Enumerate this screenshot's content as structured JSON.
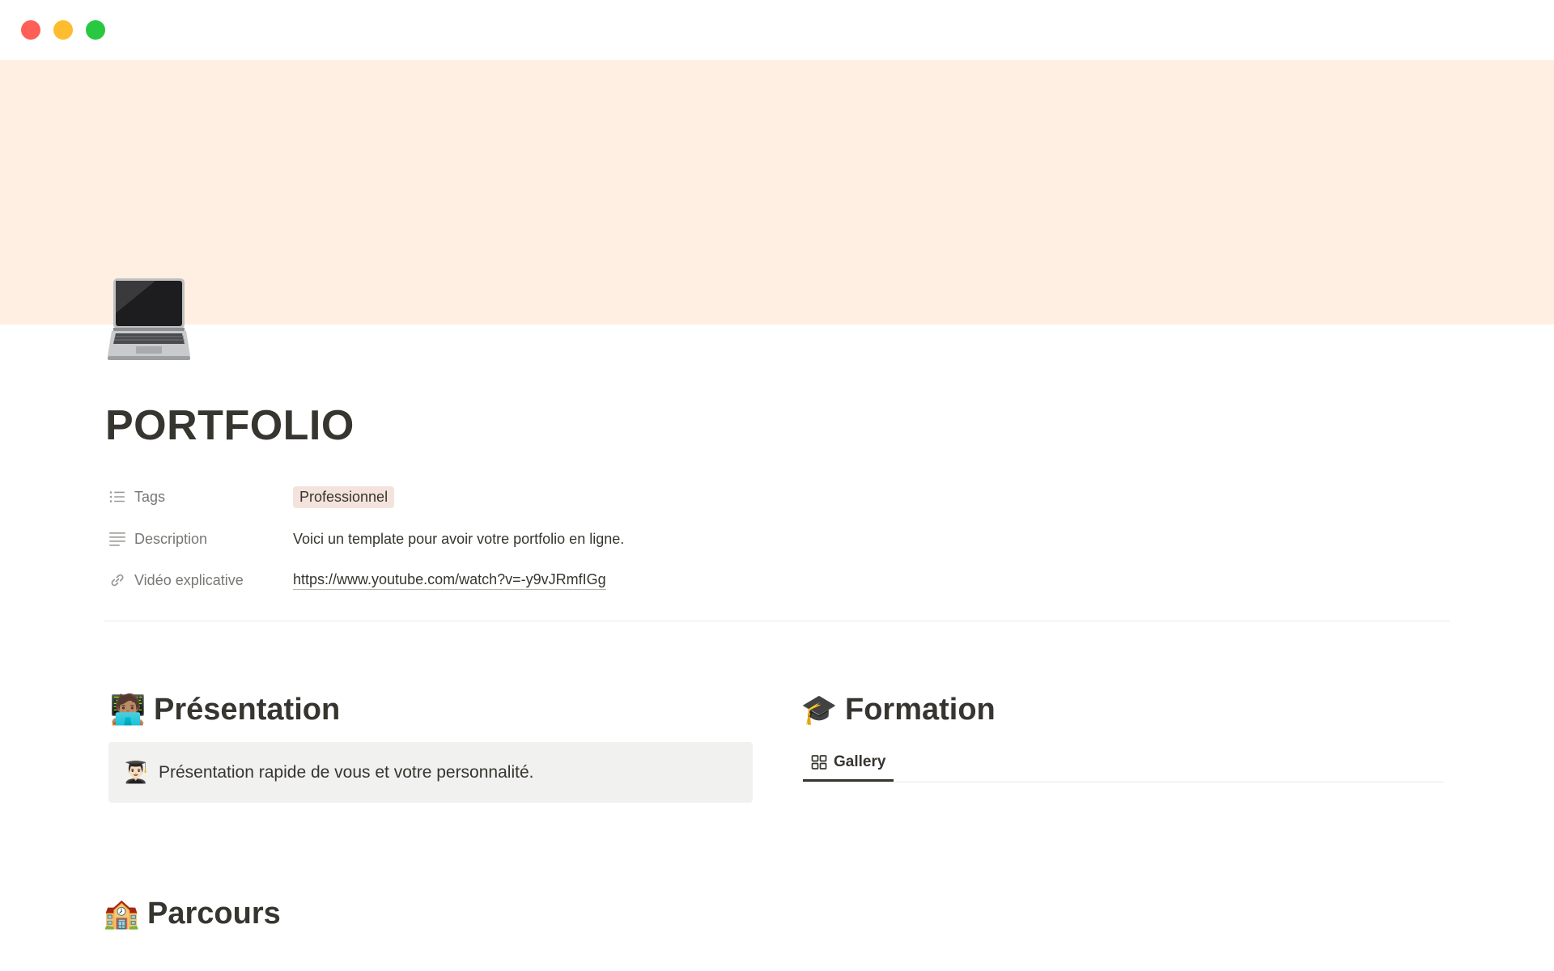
{
  "window": {
    "controls": [
      "close",
      "minimize",
      "maximize"
    ]
  },
  "page": {
    "icon": "laptop-icon",
    "title": "PORTFOLIO",
    "cover_color": "#ffefe2"
  },
  "properties": [
    {
      "name": "Tags",
      "icon": "list-icon",
      "value": "Professionnel"
    },
    {
      "name": "Description",
      "icon": "text-lines-icon",
      "value": "Voici un template pour avoir votre portfolio en ligne."
    },
    {
      "name": "Vidéo explicative",
      "icon": "link-icon",
      "value": "https://www.youtube.com/watch?v=-y9vJRmfIGg"
    }
  ],
  "sections": {
    "presentation": {
      "emoji": "🧑🏽‍💻",
      "title": "Présentation",
      "callout": {
        "emoji": "👨🏻‍🎓",
        "text": "Présentation rapide de vous et votre personnalité."
      }
    },
    "formation": {
      "emoji": "🎓",
      "title": "Formation",
      "tabs": [
        {
          "label": "Gallery",
          "icon": "gallery-grid-icon",
          "active": true
        }
      ]
    },
    "parcours": {
      "emoji": "🏫",
      "title": "Parcours"
    }
  }
}
